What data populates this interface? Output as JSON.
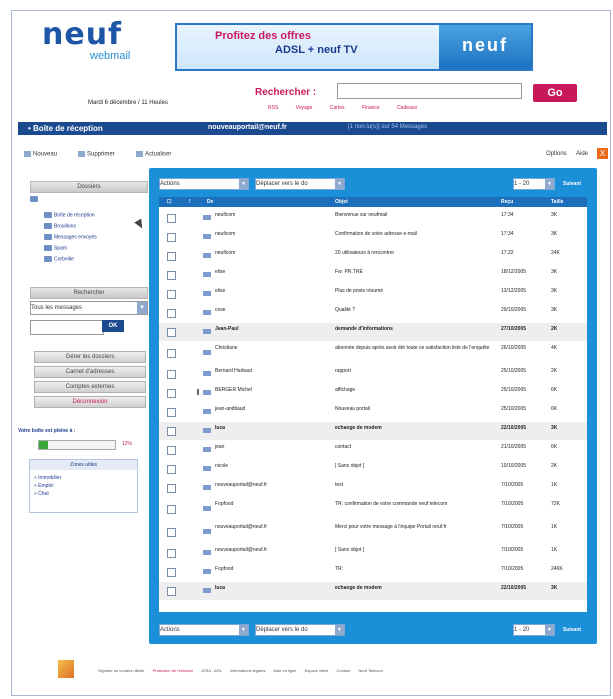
{
  "header": {
    "logo_text": "neuf",
    "logo_sub": "webmail",
    "banner_line1": "Profitez des offres",
    "banner_line2": "ADSL + neuf TV",
    "banner_logo": "neuf",
    "date": "Mardi 6 décembre / 11 Heules",
    "search_label": "Rechercher :",
    "search_button": "Go",
    "search_links": [
      "RSS",
      "Voyage",
      "Cartes",
      "Finance",
      "Cadeaux"
    ]
  },
  "bluebar": {
    "title": "• Boîte de réception",
    "email": "nouveauportail@neuf.fr",
    "count": "[1 non lu(s)] sur 54 Messages"
  },
  "toolbar": {
    "new": "Nouveau",
    "delete": "Supprimer",
    "refresh": "Actualiser",
    "options": "Options",
    "help": "Aide",
    "close": "X"
  },
  "sidebar": {
    "folders_head": "Dossiers",
    "folders": [
      "Boîte de réception",
      "Brouillons",
      "Messages envoyés",
      "Spam",
      "Corbeille"
    ],
    "search_head": "Rechercher",
    "search_select": "Tous les messages",
    "ok_label": "OK",
    "buttons": [
      "Gérer les dossiers",
      "Carnet d'adresses",
      "Comptes externes",
      "Déconnexion"
    ],
    "quota_label": "Votre boîte est pleine à :",
    "quota_pct": "12%",
    "quota_fill": 0.12,
    "zones_head": "Zones utiles",
    "zones": [
      "» Immobilier",
      "» Emploi",
      "» Chat"
    ]
  },
  "main": {
    "actions": "Actions",
    "move_to": "Déplacer vers le do",
    "page_range": "1 - 20",
    "next": "Suivant",
    "columns": [
      "De",
      "Objet",
      "Reçu",
      "Taille"
    ],
    "rows": [
      {
        "from": "neuficom",
        "subject": "Bienvenue sur neufmail",
        "date": "17:34",
        "size": "3K",
        "bold": false
      },
      {
        "from": "neuficom",
        "subject": "Confirmation de votre adresse e-mail",
        "date": "17:34",
        "size": "3K",
        "bold": false
      },
      {
        "from": "neuficom",
        "subject": "20 utilisateurs à rencontrer",
        "date": "17:22",
        "size": "24K",
        "bold": false
      },
      {
        "from": "elise",
        "subject": "Fw: PR.TRE",
        "date": "18/12/2005",
        "size": "3K",
        "bold": false
      },
      {
        "from": "elise",
        "subject": "Plus de posts résumé",
        "date": "13/12/2005",
        "size": "3K",
        "bold": false
      },
      {
        "from": "cose",
        "subject": "Qualité ?",
        "date": "29/10/2005",
        "size": "3K",
        "bold": false
      },
      {
        "from": "Jean-Paul",
        "subject": "demande d'informations",
        "date": "27/10/2005",
        "size": "2K",
        "bold": true
      },
      {
        "from": "Christiane",
        "subject": "abonnée depuis après avoir été toute ce satisfaction liste de l'enquête",
        "date": "26/10/2005",
        "size": "4K",
        "bold": false
      },
      {
        "from": "Bernard Harbaut",
        "subject": "rapport",
        "date": "25/10/2005",
        "size": "2K",
        "bold": false
      },
      {
        "from": "BERGER Michel",
        "subject": "affichage",
        "date": "25/10/2005",
        "size": "6K",
        "bold": false
      },
      {
        "from": "jean-andtiaud",
        "subject": "Nouveau portail",
        "date": "25/10/2005",
        "size": "6K",
        "bold": false
      },
      {
        "from": "luca",
        "subject": "echange de modem",
        "date": "22/10/2005",
        "size": "3K",
        "bold": true
      },
      {
        "from": "jean",
        "subject": "contact",
        "date": "21/10/2005",
        "size": "6K",
        "bold": false
      },
      {
        "from": "nicole",
        "subject": "[ Sans objet ]",
        "date": "10/10/2005",
        "size": "2K",
        "bold": false
      },
      {
        "from": "nouveauportail@neuf.fr",
        "subject": "test",
        "date": "7/10/2005",
        "size": "1K",
        "bold": false
      },
      {
        "from": "Fopfood",
        "subject": "TR: confirmation de votre commande neuf telecom",
        "date": "7/10/2005",
        "size": "72K",
        "bold": false
      },
      {
        "from": "nouveauportail@neuf.fr",
        "subject": "Merci pour votre message à l'équipe Portail neuf.fr",
        "date": "7/10/2005",
        "size": "1K",
        "bold": false
      },
      {
        "from": "nouveauportail@neuf.fr",
        "subject": "[ Sans objet ]",
        "date": "7/10/2005",
        "size": "1K",
        "bold": false
      },
      {
        "from": "Fopfood",
        "subject": "TR:",
        "date": "7/10/2005",
        "size": "246K",
        "bold": false
      },
      {
        "from": "luca",
        "subject": "echange de modem",
        "date": "22/10/2005",
        "size": "3K",
        "bold": true
      }
    ]
  },
  "footer": {
    "links": [
      "Signaler un contenu illicite",
      "Protection de l'enfance",
      "ICRA - AFA",
      "Informations légales",
      "Aide en ligne",
      "Espace client",
      "Contact",
      "Neuf Telecom"
    ]
  }
}
